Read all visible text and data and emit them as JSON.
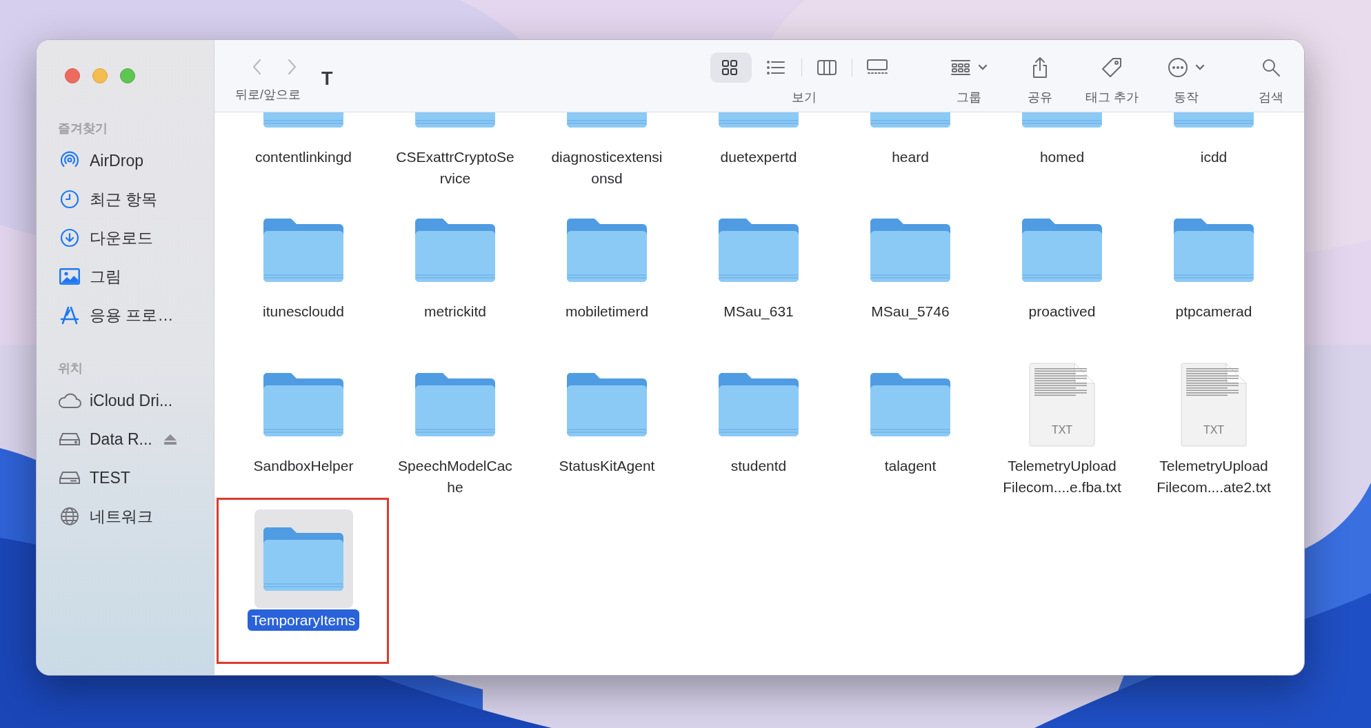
{
  "window": {
    "title": "T"
  },
  "toolbar": {
    "nav_label": "뒤로/앞으로",
    "back_disabled": true,
    "forward_disabled": true,
    "view_modes": [
      {
        "selected": true
      },
      {
        "selected": false
      },
      {
        "selected": false
      },
      {
        "selected": false
      }
    ],
    "view_label": "보기",
    "group_label": "그룹",
    "share_label": "공유",
    "tag_label": "태그 추가",
    "action_label": "동작",
    "search_label": "검색"
  },
  "sidebar": {
    "sections": [
      {
        "title": "즐겨찾기",
        "items": [
          {
            "label": "AirDrop"
          },
          {
            "label": "최근 항목"
          },
          {
            "label": "다운로드"
          },
          {
            "label": "그림"
          },
          {
            "label": "응용 프로…"
          }
        ]
      },
      {
        "title": "위치",
        "items": [
          {
            "label": "iCloud Dri..."
          },
          {
            "label": "Data R...",
            "eject": true
          },
          {
            "label": "TEST"
          },
          {
            "label": "네트워크"
          }
        ]
      }
    ]
  },
  "files": [
    {
      "kind": "folder",
      "lines": [
        "contentlinkingd"
      ],
      "selected": false
    },
    {
      "kind": "folder",
      "lines": [
        "CSExattrCryptoSe",
        "rvice"
      ],
      "selected": false
    },
    {
      "kind": "folder",
      "lines": [
        "diagnosticextensi",
        "onsd"
      ],
      "selected": false
    },
    {
      "kind": "folder",
      "lines": [
        "duetexpertd"
      ],
      "selected": false
    },
    {
      "kind": "folder",
      "lines": [
        "heard"
      ],
      "selected": false
    },
    {
      "kind": "folder",
      "lines": [
        "homed"
      ],
      "selected": false
    },
    {
      "kind": "folder",
      "lines": [
        "icdd"
      ],
      "selected": false
    },
    {
      "kind": "folder",
      "lines": [
        "itunescloudd"
      ],
      "selected": false
    },
    {
      "kind": "folder",
      "lines": [
        "metrickitd"
      ],
      "selected": false
    },
    {
      "kind": "folder",
      "lines": [
        "mobiletimerd"
      ],
      "selected": false
    },
    {
      "kind": "folder",
      "lines": [
        "MSau_631"
      ],
      "selected": false
    },
    {
      "kind": "folder",
      "lines": [
        "MSau_5746"
      ],
      "selected": false
    },
    {
      "kind": "folder",
      "lines": [
        "proactived"
      ],
      "selected": false
    },
    {
      "kind": "folder",
      "lines": [
        "ptpcamerad"
      ],
      "selected": false
    },
    {
      "kind": "folder",
      "lines": [
        "SandboxHelper"
      ],
      "selected": false
    },
    {
      "kind": "folder",
      "lines": [
        "SpeechModelCac",
        "he"
      ],
      "selected": false
    },
    {
      "kind": "folder",
      "lines": [
        "StatusKitAgent"
      ],
      "selected": false
    },
    {
      "kind": "folder",
      "lines": [
        "studentd"
      ],
      "selected": false
    },
    {
      "kind": "folder",
      "lines": [
        "talagent"
      ],
      "selected": false
    },
    {
      "kind": "text_file",
      "badge": "TXT",
      "lines": [
        "TelemetryUpload",
        "Filecom....e.fba.txt"
      ],
      "selected": false
    },
    {
      "kind": "text_file",
      "badge": "TXT",
      "lines": [
        "TelemetryUpload",
        "Filecom....ate2.txt"
      ],
      "selected": false
    },
    {
      "kind": "folder",
      "lines": [
        "TemporaryItems"
      ],
      "selected": true,
      "highlighted": true
    }
  ]
}
